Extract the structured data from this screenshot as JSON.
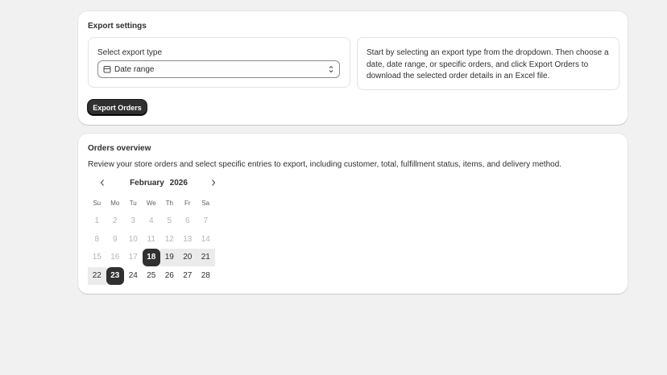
{
  "export_settings": {
    "title": "Export settings",
    "select_label": "Select export type",
    "select_value": "Date range",
    "info_text": "Start by selecting an export type from the dropdown. Then choose a date, date range, or specific orders, and click Export Orders to download the selected order details in an Excel file.",
    "export_button_label": "Export Orders"
  },
  "orders_overview": {
    "title": "Orders overview",
    "description": "Review your store orders and select specific entries to export, including customer, total, fulfillment status, items, and delivery method.",
    "calendar": {
      "month": "February",
      "year": "2026",
      "weekdays": [
        "Su",
        "Mo",
        "Tu",
        "We",
        "Th",
        "Fr",
        "Sa"
      ],
      "weeks": [
        [
          "1",
          "2",
          "3",
          "4",
          "5",
          "6",
          "7"
        ],
        [
          "8",
          "9",
          "10",
          "11",
          "12",
          "13",
          "14"
        ],
        [
          "15",
          "16",
          "17",
          "18",
          "19",
          "20",
          "21"
        ],
        [
          "22",
          "23",
          "24",
          "25",
          "26",
          "27",
          "28"
        ]
      ],
      "range_start": "18",
      "range_end": "23",
      "disabled_before": "18"
    }
  },
  "colors": {
    "background": "#f1f1f1",
    "card": "#ffffff",
    "primary": "#303030",
    "range": "#ebebeb",
    "disabled_text": "#b5b5b5"
  },
  "icons": {
    "select_icon": "calendar-icon",
    "select_chevron": "select-chevron-icon",
    "prev": "chevron-left-icon",
    "next": "chevron-right-icon"
  }
}
